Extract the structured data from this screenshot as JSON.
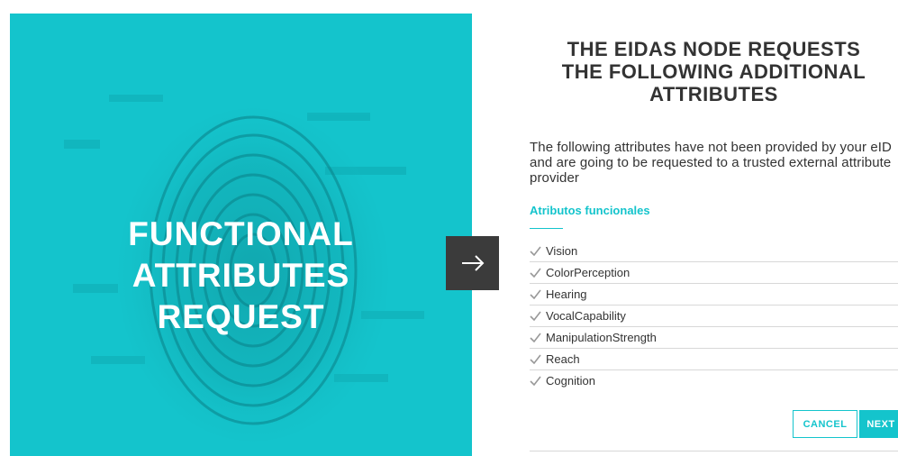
{
  "colors": {
    "accent": "#14c4cc",
    "dark_button": "#3b3b3b",
    "text": "#333333"
  },
  "hero": {
    "title": "FUNCTIONAL\nATTRIBUTES\nREQUEST",
    "image": "fingerprint-image"
  },
  "arrow_button": {
    "icon": "arrow-right-icon"
  },
  "panel": {
    "title": "THE EIDAS NODE REQUESTS\nTHE FOLLOWING ADDITIONAL\nATTRIBUTES",
    "intro": "The following attributes have not been provided by your eID and are going to be requested to a trusted external attribute provider",
    "section_label": "Atributos funcionales",
    "attributes": [
      {
        "label": "Vision"
      },
      {
        "label": "ColorPerception"
      },
      {
        "label": "Hearing"
      },
      {
        "label": "VocalCapability"
      },
      {
        "label": "ManipulationStrength"
      },
      {
        "label": "Reach"
      },
      {
        "label": "Cognition"
      }
    ],
    "cancel_label": "CANCEL",
    "next_label": "NEXT"
  }
}
